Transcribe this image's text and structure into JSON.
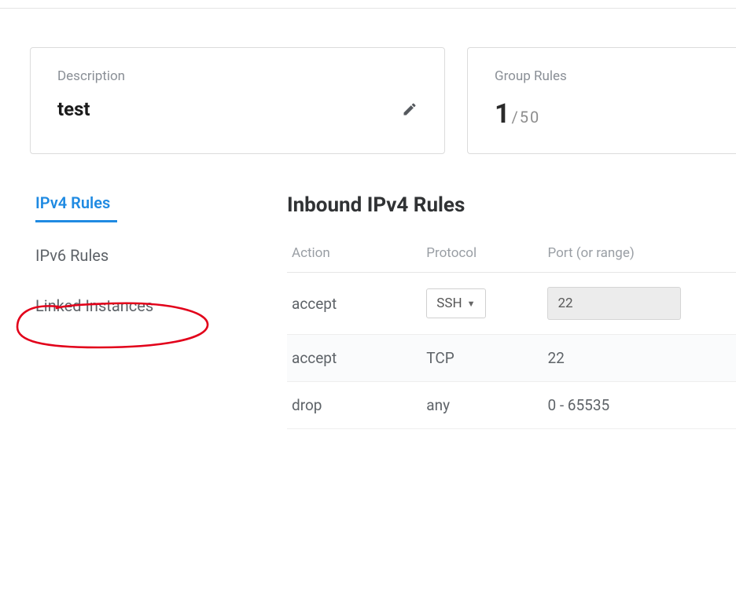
{
  "header": {
    "description_label": "Description",
    "description_value": "test",
    "group_rules_label": "Group Rules",
    "group_rules_current": "1",
    "group_rules_max": "/50"
  },
  "sidebar": {
    "items": [
      {
        "label": "IPv4 Rules",
        "active": true
      },
      {
        "label": "IPv6 Rules",
        "active": false
      },
      {
        "label": "Linked Instances",
        "active": false
      }
    ]
  },
  "content": {
    "title": "Inbound IPv4 Rules",
    "columns": {
      "action": "Action",
      "protocol": "Protocol",
      "port": "Port (or range)"
    },
    "rows": [
      {
        "action": "accept",
        "protocol": "SSH",
        "protocol_dropdown": true,
        "port": "22",
        "port_input": true
      },
      {
        "action": "accept",
        "protocol": "TCP",
        "protocol_dropdown": false,
        "port": "22",
        "port_input": false
      },
      {
        "action": "drop",
        "protocol": "any",
        "protocol_dropdown": false,
        "port": "0 - 65535",
        "port_input": false
      }
    ]
  }
}
